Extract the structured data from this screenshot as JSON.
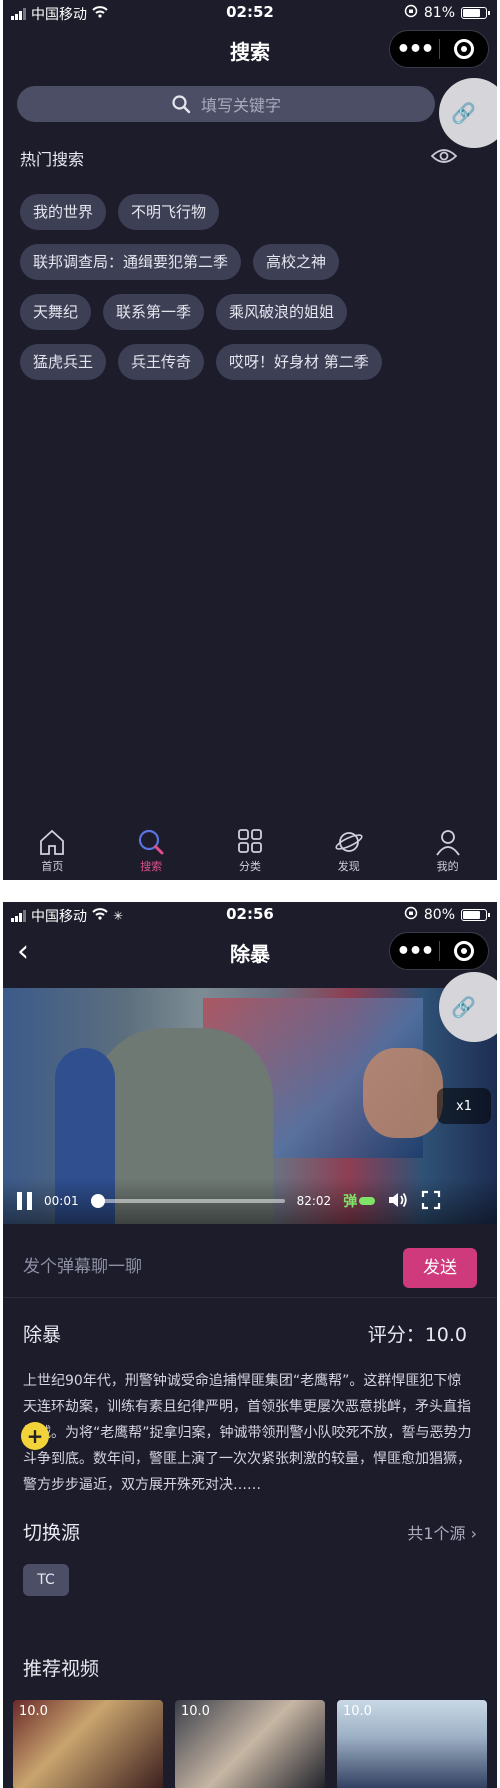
{
  "screen1": {
    "status": {
      "carrier": "中国移动",
      "time": "02:52",
      "battery": "81%",
      "battery_level": 0.81
    },
    "nav": {
      "title": "搜索"
    },
    "search": {
      "placeholder": "填写关键字"
    },
    "hot": {
      "title": "热门搜索",
      "rows": [
        [
          "我的世界",
          "不明飞行物"
        ],
        [
          "联邦调查局：通缉要犯第二季",
          "高校之神"
        ],
        [
          "天舞纪",
          "联系第一季",
          "乘风破浪的姐姐"
        ],
        [
          "猛虎兵王",
          "兵王传奇",
          "哎呀！好身材 第二季"
        ]
      ]
    },
    "tabs": [
      {
        "label": "首页",
        "icon": "home-icon"
      },
      {
        "label": "搜索",
        "icon": "search-icon"
      },
      {
        "label": "分类",
        "icon": "category-icon"
      },
      {
        "label": "发现",
        "icon": "discover-icon"
      },
      {
        "label": "我的",
        "icon": "profile-icon"
      }
    ],
    "accent": "#e04f8d"
  },
  "screen2": {
    "status": {
      "carrier": "中国移动",
      "time": "02:56",
      "battery": "80%",
      "battery_level": 0.8
    },
    "nav": {
      "title": "除暴"
    },
    "player": {
      "current_time": "00:01",
      "duration": "82:02",
      "progress": 0.0002,
      "danmu_toggle": "弹",
      "speed": "x1"
    },
    "danmu": {
      "placeholder": "发个弹幕聊一聊",
      "send_label": "发送"
    },
    "info": {
      "title": "除暴",
      "rating": "评分：10.0",
      "description": "上世纪90年代，刑警钟诚受命追捕悍匪集团“老鹰帮”。这群悍匪犯下惊天连环劫案，训练有素且纪律严明，首领张隼更屡次恶意挑衅，矛头直指钟诚。为将“老鹰帮”捉拿归案，钟诚带领刑警小队咬死不放，誓与恶势力斗争到底。数年间，警匪上演了一次次紧张刺激的较量，悍匪愈加猖獗，警方步步逼近，双方展开殊死对决……"
    },
    "source": {
      "title": "切换源",
      "count": "共1个源",
      "tags": [
        "TC"
      ]
    },
    "recommend": {
      "title": "推荐视频",
      "items": [
        {
          "score": "10.0"
        },
        {
          "score": "10.0"
        },
        {
          "score": "10.0"
        }
      ]
    },
    "accent": "#cf3a7c"
  }
}
